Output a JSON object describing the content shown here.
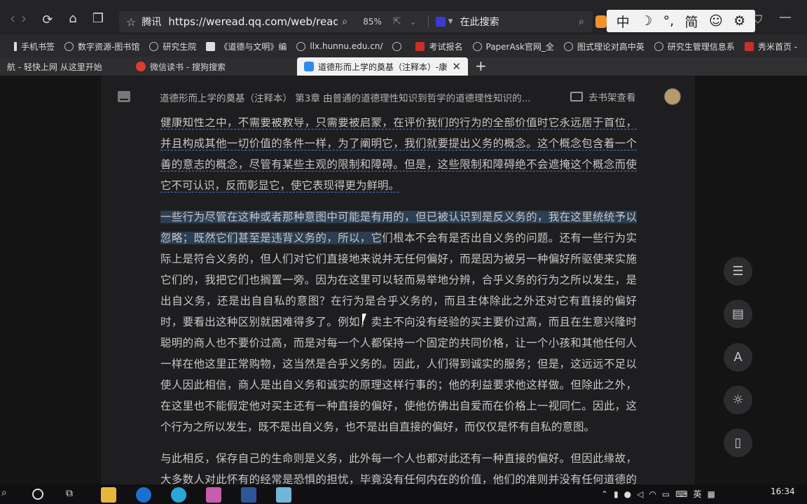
{
  "browser": {
    "back_icon": "back-arrow-icon",
    "forward_icon": "forward-arrow-icon",
    "site_name": "腾讯",
    "url": "https://weread.qq.com/web/reader/c",
    "zoom": "85%",
    "search_placeholder": "在此搜索",
    "ime": [
      "中",
      "☽",
      "°,",
      "简",
      "☺",
      "⚙"
    ]
  },
  "bookmarks": [
    {
      "label": "手机书签"
    },
    {
      "label": "数字资源-图书馆"
    },
    {
      "label": "研究生院"
    },
    {
      "label": "《道德与文明》编"
    },
    {
      "label": "llx.hunnu.edu.cn/"
    },
    {
      "label": ""
    },
    {
      "label": "考试报名"
    },
    {
      "label": "PaperAsk官网_全"
    },
    {
      "label": "图式理论对高中英"
    },
    {
      "label": "研究生管理信息系"
    },
    {
      "label": "秀米首页 -"
    }
  ],
  "tabs": [
    {
      "label": "航 - 轻快上网 从这里开始"
    },
    {
      "label": "微信读书 - 搜狗搜索"
    },
    {
      "label": "道德形而上学的奠基（注释本）-康德"
    }
  ],
  "reader": {
    "title": "道德形而上学的奠基（注释本） 第3章 由普通的道德理性知识到哲学的道德理性知识的...",
    "shelf_label": "去书架查看",
    "paragraphs": {
      "p1": "健康知性之中，不需要被教导，只需要被启蒙，在评价我们的行为的全部价值时它永远居于首位，并且构成其他一切价值的条件一样，为了阐明它，我们就要提出义务的概念。这个概念包含着一个善的意志的概念，尽管有某些主观的限制和障碍。但是，这些限制和障碍绝不会遮掩这个概念而使它不可认识，反而彰显它，使它表现得更为鲜明。",
      "p2_highlight": "一些行为尽管在这种或者那种意图中可能是有用的，但已被认识到是反义务的，我在这里统统予以忽略；既然它们甚至是违背义务的，所以，它",
      "p2_rest": "们根本不会有是否出自义务的问题。还有一些行为实际上是符合义务的，但人们对它们直接地来说并无任何偏好，而是因为被另一种偏好所驱使来实施它们的，我把它们也搁置一旁。因为在这里可以轻而易举地分辨，合乎义务的行为之所以发生，是出自义务，还是出自自私的意图？在行为是合乎义务的，而且主体除此之外还对它有直接的偏好时，要看出这种区别就困难得多了。例如，卖主不向没有经验的买主要价过高，而且在生意兴隆时聪明的商人也不要价过高，而是对每一个人都保持一个固定的共同价格，让一个小孩和其他任何人一样在他这里正常购物，这当然是合乎义务的。因此，人们得到诚实的服务；但是，这远远不足以使人因此相信，商人是出自义务和诚实的原理这样行事的；他的利益要求他这样做。但除此之外，在这里也不能假定他对买主还有一种直接的偏好，使他仿佛出自爱而在价格上一视同仁。因此，这个行为之所以发生，既不是出自义务，也不是出自直接的偏好，而仅仅是怀有自私的意图。",
      "p3": "与此相反，保存自己的生命则是义务，此外每一个人也都对此还有一种直接的偏好。但因此缘故，大多数人对此怀有的经常是恐惧的担忧，毕竟没有任何内在的价值，他们的准则并没有任何道德的内"
    }
  },
  "side_tools": [
    "menu-icon",
    "comment-icon",
    "font-icon",
    "brightness-icon",
    "phone-icon"
  ],
  "taskbar": {
    "time": "16:34",
    "ime_lang": "英"
  },
  "colors": {
    "page_bg": "#141415",
    "reader_bg": "#1e1e20",
    "text": "#c7c7c7",
    "highlight": "#2c3e52",
    "underline": "#3b7fd8"
  }
}
